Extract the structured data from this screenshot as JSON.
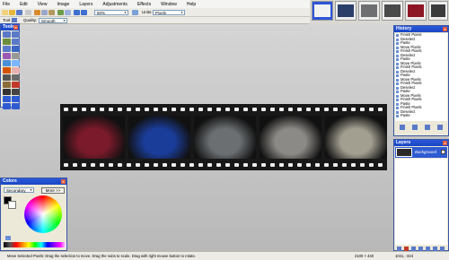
{
  "menu": [
    "File",
    "Edit",
    "View",
    "Image",
    "Layers",
    "Adjustments",
    "Effects",
    "Window",
    "Help"
  ],
  "toolbar": {
    "zoom_value": "50%",
    "units_label": "Units:",
    "units_value": "Pixels",
    "tool_label": "Tool:",
    "quality_label": "Quality:",
    "quality_value": "Smooth"
  },
  "tools_window": {
    "title": "Tools"
  },
  "colors_window": {
    "title": "Colors",
    "mode_value": "Secondary",
    "more_button": "More >>"
  },
  "history_window": {
    "title": "History",
    "items": [
      "Finish Pixels",
      "Deselect",
      "Paste",
      "Move Pixels",
      "Finish Pixels",
      "Deselect",
      "Paste",
      "Move Pixels",
      "Finish Pixels",
      "Deselect",
      "Paste",
      "Move Pixels",
      "Finish Pixels",
      "Deselect",
      "Paste",
      "Move Pixels",
      "Finish Pixels",
      "Paste",
      "Finish Pixels",
      "Deselect",
      "Paste"
    ]
  },
  "layers_window": {
    "title": "Layers",
    "layer_name": "Background"
  },
  "status": {
    "hint": "Move Selected Pixels: Drag the selection to move. Drag the nubs to scale. Drag with right mouse button to rotate.",
    "size": "2100 × 440",
    "pos": "1041, -324"
  },
  "film_frames": [
    {
      "name": "red-coupe",
      "color": "#7a1a2a"
    },
    {
      "name": "blue-sedan",
      "color": "#1b3d9a"
    },
    {
      "name": "grey-sportscar",
      "color": "#6b6f72"
    },
    {
      "name": "silver-roadster",
      "color": "#8c8a86"
    },
    {
      "name": "silver-coupe",
      "color": "#a29e90"
    }
  ]
}
